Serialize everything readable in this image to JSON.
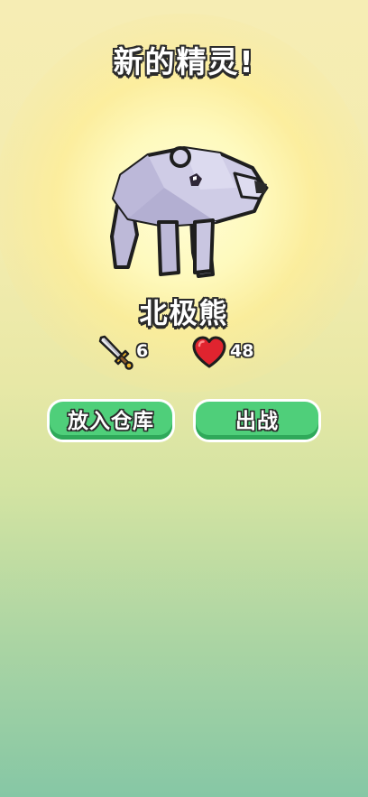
{
  "title": "新的精灵!",
  "creature": {
    "name": "北极熊",
    "image": "polar-bear-lowpoly"
  },
  "stats": {
    "attack": {
      "icon": "sword-icon",
      "value": "6"
    },
    "health": {
      "icon": "heart-icon",
      "value": "48"
    }
  },
  "buttons": {
    "store_label": "放入仓库",
    "battle_label": "出战"
  },
  "colors": {
    "button_green": "#4fcf7a",
    "button_shadow": "#2fa95a",
    "bear_body": "#cac7e0",
    "heart": "#e0242f"
  }
}
